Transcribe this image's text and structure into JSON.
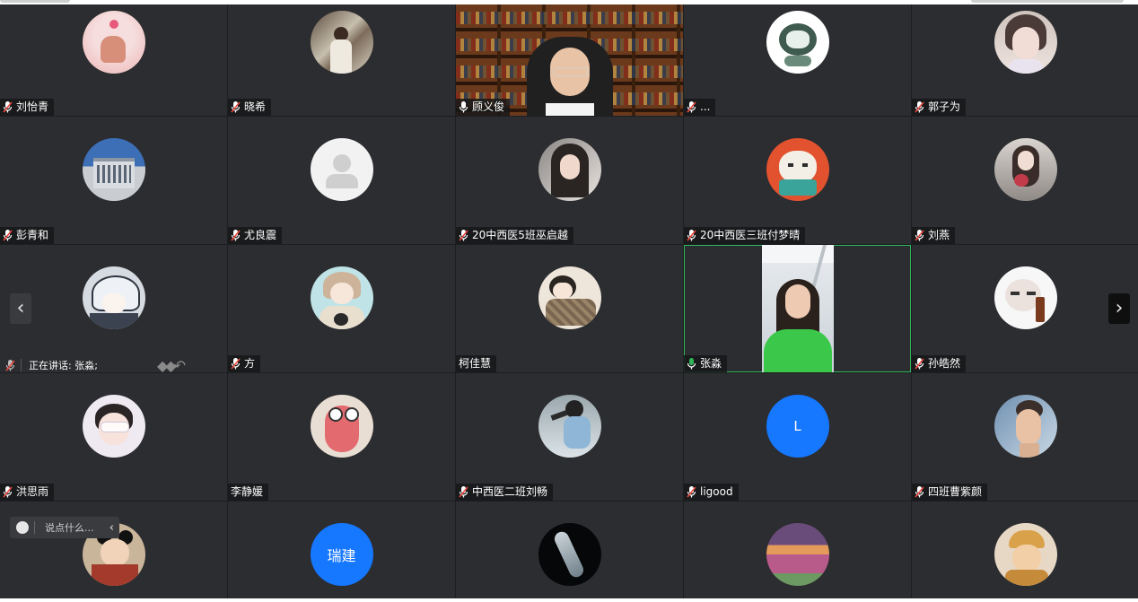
{
  "participants": [
    {
      "name": "刘怡青"
    },
    {
      "name": "晓希"
    },
    {
      "name": "顾义俊"
    },
    {
      "name": "..."
    },
    {
      "name": "郭子为"
    },
    {
      "name": "彭青和"
    },
    {
      "name": "尤良震"
    },
    {
      "name": "20中西医5班巫启越"
    },
    {
      "name": "20中西医三班付梦晴"
    },
    {
      "name": "刘燕"
    },
    {
      "name": ""
    },
    {
      "name": "方"
    },
    {
      "name": "柯佳慧"
    },
    {
      "name": "张淼"
    },
    {
      "name": "孙皓然"
    },
    {
      "name": "洪思雨"
    },
    {
      "name": "李静媛"
    },
    {
      "name": "中西医二班刘畅"
    },
    {
      "name": "ligood"
    },
    {
      "name": "四班曹紫颜"
    },
    {
      "name": ""
    },
    {
      "name": "瑞建",
      "avatar_text": "瑞建"
    },
    {
      "name": ""
    },
    {
      "name": ""
    },
    {
      "name": ""
    }
  ],
  "ligood_avatar_letter": "L",
  "speaking_status": "正在讲话: 张淼;",
  "chat_placeholder": "说点什么...",
  "nav": {
    "prev": "‹",
    "next": "›"
  },
  "colors": {
    "background": "#1d1e21",
    "tile": "#2c2d30",
    "speaking_border": "#2fb45a",
    "avatar_blue": "#1677ff"
  }
}
